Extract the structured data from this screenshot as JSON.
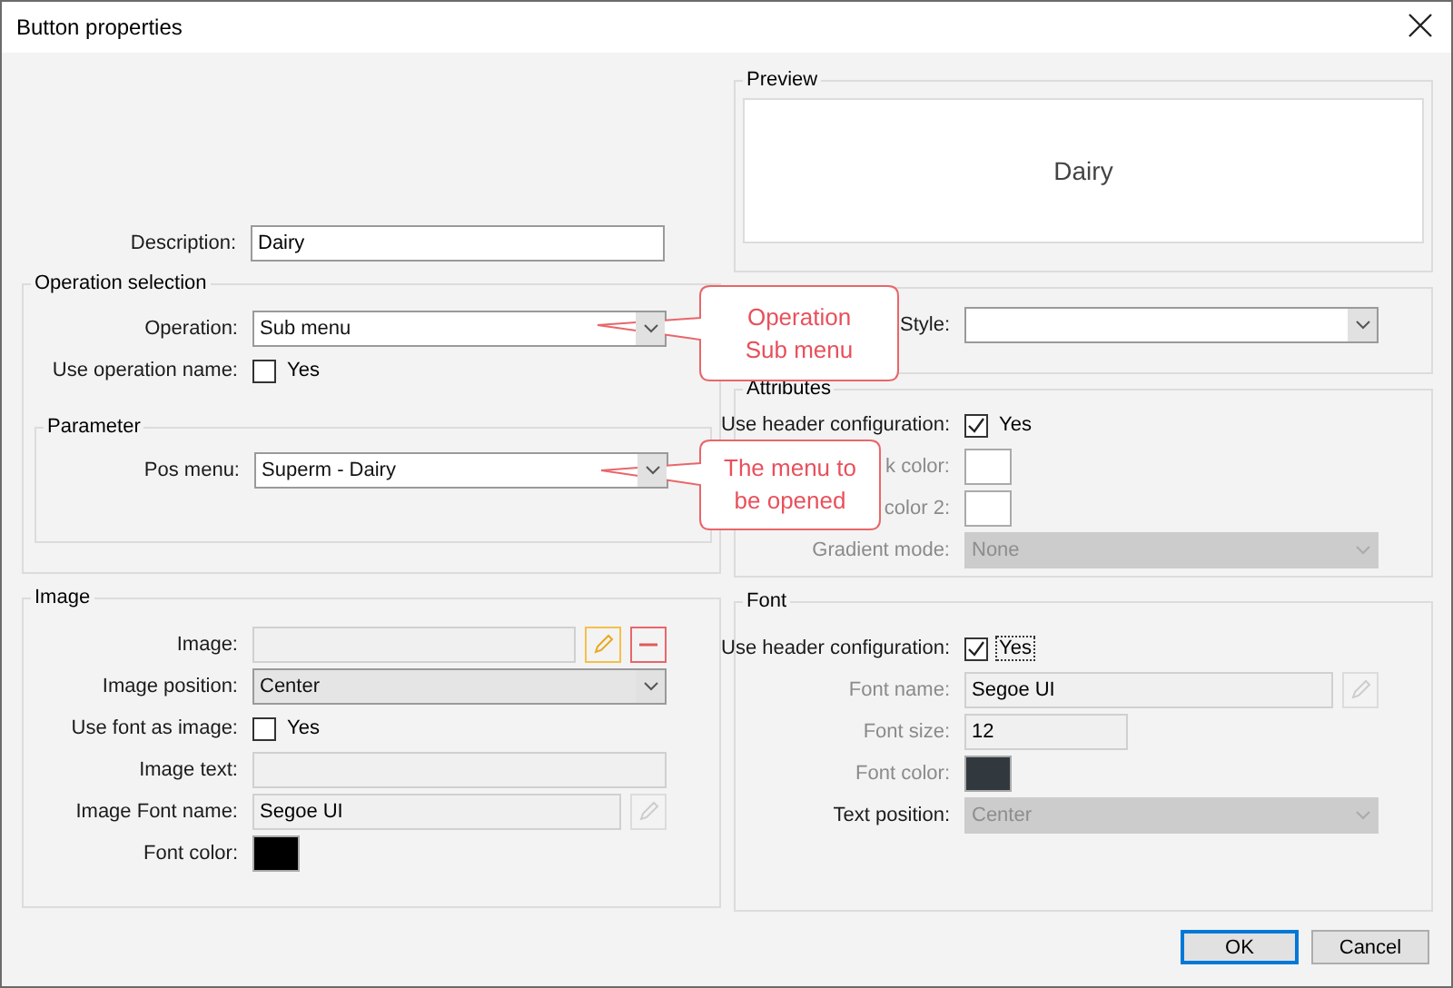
{
  "window": {
    "title": "Button properties"
  },
  "description": {
    "kind": "text",
    "label": "Description:",
    "value": "Dairy"
  },
  "operation_selection": {
    "title": "Operation selection",
    "rows": [
      {
        "kind": "select",
        "label": "Operation:",
        "value": "Sub menu"
      },
      {
        "kind": "checkbox",
        "label": "Use operation name:",
        "option": "Yes",
        "checked": false
      }
    ],
    "parameter": {
      "title": "Parameter",
      "rows": [
        {
          "kind": "select",
          "label": "Pos menu:",
          "value": "Superm - Dairy"
        }
      ]
    }
  },
  "image": {
    "title": "Image",
    "rows": [
      {
        "kind": "text",
        "label": "Image:",
        "disabled": true,
        "actions": [
          {
            "kind": "edit",
            "disabled": false
          },
          {
            "kind": "remove",
            "disabled": false
          }
        ]
      },
      {
        "kind": "select",
        "label": "Image position:",
        "value": "Center"
      },
      {
        "kind": "checkbox",
        "label": "Use font as image:",
        "option": "Yes",
        "checked": false
      },
      {
        "kind": "text",
        "label": "Image text:",
        "disabled": true
      },
      {
        "kind": "text",
        "label": "Image Font name:",
        "value": "Segoe UI",
        "disabled": true,
        "actions": [
          {
            "kind": "edit",
            "disabled": true
          }
        ]
      },
      {
        "kind": "color",
        "label": "Font color:",
        "color": "#000000"
      }
    ]
  },
  "preview": {
    "title": "Preview",
    "text": "Dairy"
  },
  "style_group": {
    "rows": [
      {
        "kind": "select",
        "label": "Style:"
      }
    ]
  },
  "attributes": {
    "title": "Attributes",
    "rows": [
      {
        "kind": "checkbox",
        "label": "Use header configuration:",
        "option": "Yes",
        "checked": true
      },
      {
        "kind": "color",
        "label": "k color:",
        "label_disabled": true,
        "color": "#ffffff"
      },
      {
        "kind": "color",
        "label": "color 2:",
        "label_disabled": true,
        "color": "#ffffff"
      },
      {
        "kind": "select",
        "label": "Gradient mode:",
        "label_disabled": true,
        "value": "None",
        "disabled": true
      }
    ]
  },
  "font": {
    "title": "Font",
    "rows": [
      {
        "kind": "checkbox",
        "label": "Use header configuration:",
        "option": "Yes",
        "checked": true,
        "focused": true
      },
      {
        "kind": "text",
        "label": "Font name:",
        "label_disabled": true,
        "value": "Segoe UI",
        "disabled": true,
        "actions": [
          {
            "kind": "edit",
            "disabled": true
          }
        ]
      },
      {
        "kind": "number",
        "label": "Font size:",
        "label_disabled": true,
        "value": "12",
        "disabled": true
      },
      {
        "kind": "color",
        "label": "Font color:",
        "label_disabled": true,
        "color": "#32393e"
      },
      {
        "kind": "select",
        "label": "Text position:",
        "value": "Center",
        "disabled": true
      }
    ]
  },
  "buttons": [
    {
      "label": "OK",
      "default": true
    },
    {
      "label": "Cancel",
      "default": false
    }
  ],
  "callouts": [
    {
      "lines": [
        "Operation",
        "Sub menu"
      ]
    },
    {
      "lines": [
        "The menu to",
        "be opened"
      ]
    }
  ]
}
